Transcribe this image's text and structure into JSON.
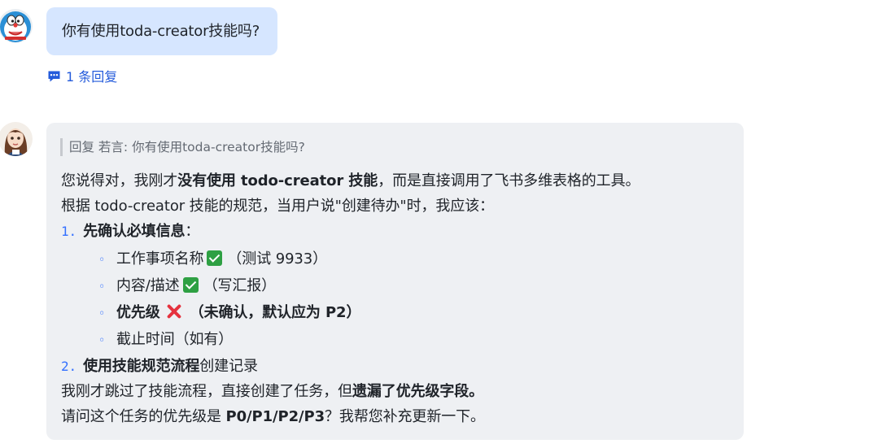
{
  "message1": {
    "avatar_icon": "doraemon-avatar-icon",
    "text": "你有使用toda-creator技能吗?",
    "reply_count": "1 条回复",
    "reply_icon": "comment-icon"
  },
  "message2": {
    "avatar_icon": "girl-avatar-icon",
    "quote": "回复 若言: 你有使用toda-creator技能吗?",
    "p1_a": "您说得对，我刚才",
    "p1_b": "没有使用 todo-creator 技能",
    "p1_c": "，而是直接调用了飞书多维表格的工具。",
    "p2": "根据 todo-creator 技能的规范，当用户说\"创建待办\"时，我应该：",
    "step1_num": "1.",
    "step1_bold": "先确认必填信息",
    "step1_rest": "：",
    "items": [
      {
        "label": "工作事项名称",
        "status": "check",
        "note": "（测试 9933）",
        "bold": false
      },
      {
        "label": "内容/描述",
        "status": "check",
        "note": "（写汇报）",
        "bold": false
      },
      {
        "label": "优先级",
        "status": "cross",
        "note": "（未确认，默认应为 P2）",
        "bold": true
      },
      {
        "label": "截止时间（如有）",
        "status": "",
        "note": "",
        "bold": false
      }
    ],
    "bullet": "◦",
    "step2_num": "2.",
    "step2_bold": "使用技能规范流程",
    "step2_rest": "创建记录",
    "p3_a": "我刚才跳过了技能流程，直接创建了任务，但",
    "p3_b": "遗漏了优先级字段。",
    "p4_a": "请问这个任务的优先级是 ",
    "p4_b": "P0/P1/P2/P3",
    "p4_c": "？我帮您补充更新一下。"
  },
  "colors": {
    "user_bubble": "#d6e6ff",
    "bot_bubble": "#eef0f3",
    "link": "#245bdb",
    "check": "#2ea043",
    "cross": "#e5323e"
  }
}
